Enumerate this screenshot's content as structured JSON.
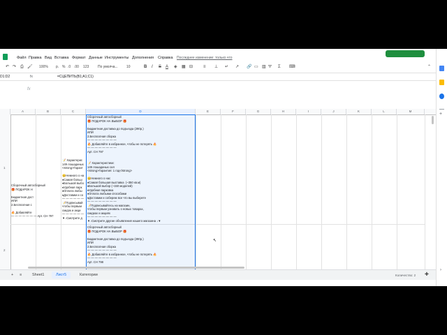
{
  "menu": {
    "items": [
      "Файл",
      "Правка",
      "Вид",
      "Вставка",
      "Формат",
      "Данные",
      "Инструменты",
      "Дополнения",
      "Справка"
    ],
    "last_edit": "Последнее изменение: только что"
  },
  "toolbar": {
    "zoom": "100%",
    "currency": "р.",
    "percent": "%",
    "decimals": ".0",
    "decimals2": ".00",
    "format_123": "123",
    "font": "По умолча...",
    "font_size": "10",
    "bold": "B",
    "italic": "I",
    "strike": "S",
    "text_color": "A"
  },
  "formula_bar": {
    "cell_ref": "D1:D2",
    "formula": "=СЦЕПИТЬ(B1;A1;C1)"
  },
  "columns": [
    "A",
    "B",
    "C",
    "D",
    "E",
    "F",
    "G",
    "H",
    "I",
    "J",
    "K",
    "L",
    "M"
  ],
  "rows": [
    "1",
    "2"
  ],
  "cells": {
    "a1": "Сборочный автосборный\n🎁 ПОДАРОК Н\n\nБюджетная дост\nИЛИ\n2.Бесплатная с\n\n🔥 Добавляйте\n— — — — — — — Арт. CH 797",
    "c1": "📝 Характерис\n149 лошадиных\n<strong>Гарант\n\n😊Немного о на\n♦Самая больш\n♦Большой выбо\n♦Удобная парк\n♦Оплата любы\n♦Доставим и со\n— — — — — —\n📝Подписывай\nчтобы первым\nскидок и акци\n— — — — — —\n▼↓Смотрите д",
    "d1": "Сборочный автосборный\n🎁 ПОДАРОК НА ВЫБОР 🎁\n\nБюджетная доставка до подъезда (290р.)\nИЛИ\n2.Бесплатная сборка\n— — — — — — — —\n🔥 Добавляйте в избранное, чтобы не потерять 🔥\n— — — — — — — —\nАрт. CH 797\n\n\n📝 Характеристики:\n149 лошадиных сил\n<strong>Гарантия: 1 год</strong>\n\n😊Немного о нас\n♦Самая большая выставка  (~350 кв.м)\n♦Большой выбор (~150 моделей)\n♦Удобная парковка\n♦Оплата любыми способами\n♦Доставим и соберем все что вы выберете\n— — — — — — — —\n📝Подписывайтесь на магазин,\nчтобы первым узнавать о новых товарах,\nскидках и акциях\n— — — — — — — —\n▼↓Смотрите другие объявления нашего магазина ↓▼",
    "d2": "Сборочный автосборный\n🎁 ПОДАРОК НА ВЫБОР 🎁\n\nБюджетная доставка до подъезда (290р.)\nИЛИ\n2.Бесплатная сборка\n— — — — — — — —\n🔥 Добавляйте в избранное, чтобы не потерять 🔥\n— — — — — — — —\nАрт. CH 798"
  },
  "tabs": {
    "add": "+",
    "list": "≡",
    "items": [
      "Sheet1",
      "Лист5",
      "Категории"
    ]
  },
  "status": {
    "count": "Количество: 2"
  },
  "colors": {
    "accent": "#1a73e8",
    "share": "#1e8e3e"
  }
}
